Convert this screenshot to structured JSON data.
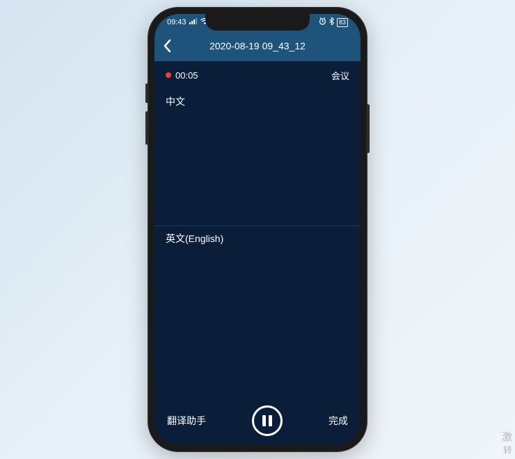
{
  "status": {
    "time": "09:43",
    "signal_icon": "signal",
    "wifi_icon": "wifi",
    "alarm_icon": "alarm",
    "bt_icon": "bluetooth",
    "battery": "83"
  },
  "nav": {
    "back_icon": "chevron-left",
    "title": "2020-08-19 09_43_12"
  },
  "recording": {
    "elapsed": "00:05",
    "mode_label": "会议"
  },
  "panes": {
    "source_lang": "中文",
    "target_lang": "英文(English)"
  },
  "footer": {
    "left_label": "翻译助手",
    "center_icon": "pause",
    "right_label": "完成"
  },
  "watermark": {
    "line1": "激",
    "line2": "转"
  }
}
